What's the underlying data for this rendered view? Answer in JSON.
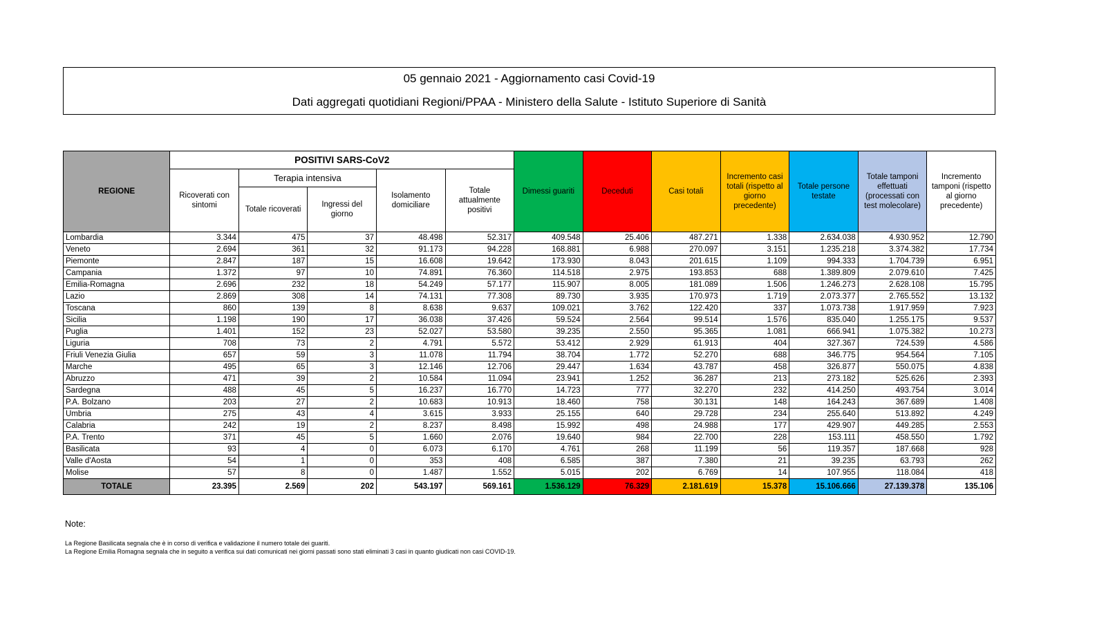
{
  "title": "05 gennaio 2021 - Aggiornamento casi Covid-19",
  "subtitle": "Dati aggregati quotidiani Regioni/PPAA - Ministero della Salute - Istituto Superiore di Sanità",
  "headers": {
    "regione": "REGIONE",
    "positivi": "POSITIVI SARS-CoV2",
    "terapia": "Terapia intensiva",
    "ricoverati": "Ricoverati con sintomi",
    "totale_ricoverati": "Totale ricoverati",
    "ingressi": "Ingressi del giorno",
    "isolamento": "Isolamento domiciliare",
    "totale_positivi": "Totale attualmente positivi",
    "dimessi": "Dimessi guariti",
    "deceduti": "Deceduti",
    "casi_totali": "Casi totali",
    "incremento_casi": "Incremento casi totali (rispetto al giorno precedente)",
    "persone_testate": "Totale persone testate",
    "tamponi": "Totale tamponi effettuati (processati con test molecolare)",
    "incremento_tamponi": "Incremento tamponi (rispetto al giorno precedente)"
  },
  "rows": [
    [
      "Lombardia",
      "3.344",
      "475",
      "37",
      "48.498",
      "52.317",
      "409.548",
      "25.406",
      "487.271",
      "1.338",
      "2.634.038",
      "4.930.952",
      "12.790"
    ],
    [
      "Veneto",
      "2.694",
      "361",
      "32",
      "91.173",
      "94.228",
      "168.881",
      "6.988",
      "270.097",
      "3.151",
      "1.235.218",
      "3.374.382",
      "17.734"
    ],
    [
      "Piemonte",
      "2.847",
      "187",
      "15",
      "16.608",
      "19.642",
      "173.930",
      "8.043",
      "201.615",
      "1.109",
      "994.333",
      "1.704.739",
      "6.951"
    ],
    [
      "Campania",
      "1.372",
      "97",
      "10",
      "74.891",
      "76.360",
      "114.518",
      "2.975",
      "193.853",
      "688",
      "1.389.809",
      "2.079.610",
      "7.425"
    ],
    [
      "Emilia-Romagna",
      "2.696",
      "232",
      "18",
      "54.249",
      "57.177",
      "115.907",
      "8.005",
      "181.089",
      "1.506",
      "1.246.273",
      "2.628.108",
      "15.795"
    ],
    [
      "Lazio",
      "2.869",
      "308",
      "14",
      "74.131",
      "77.308",
      "89.730",
      "3.935",
      "170.973",
      "1.719",
      "2.073.377",
      "2.765.552",
      "13.132"
    ],
    [
      "Toscana",
      "860",
      "139",
      "8",
      "8.638",
      "9.637",
      "109.021",
      "3.762",
      "122.420",
      "337",
      "1.073.738",
      "1.917.959",
      "7.923"
    ],
    [
      "Sicilia",
      "1.198",
      "190",
      "17",
      "36.038",
      "37.426",
      "59.524",
      "2.564",
      "99.514",
      "1.576",
      "835.040",
      "1.255.175",
      "9.537"
    ],
    [
      "Puglia",
      "1.401",
      "152",
      "23",
      "52.027",
      "53.580",
      "39.235",
      "2.550",
      "95.365",
      "1.081",
      "666.941",
      "1.075.382",
      "10.273"
    ],
    [
      "Liguria",
      "708",
      "73",
      "2",
      "4.791",
      "5.572",
      "53.412",
      "2.929",
      "61.913",
      "404",
      "327.367",
      "724.539",
      "4.586"
    ],
    [
      "Friuli Venezia Giulia",
      "657",
      "59",
      "3",
      "11.078",
      "11.794",
      "38.704",
      "1.772",
      "52.270",
      "688",
      "346.775",
      "954.564",
      "7.105"
    ],
    [
      "Marche",
      "495",
      "65",
      "3",
      "12.146",
      "12.706",
      "29.447",
      "1.634",
      "43.787",
      "458",
      "326.877",
      "550.075",
      "4.838"
    ],
    [
      "Abruzzo",
      "471",
      "39",
      "2",
      "10.584",
      "11.094",
      "23.941",
      "1.252",
      "36.287",
      "213",
      "273.182",
      "525.626",
      "2.393"
    ],
    [
      "Sardegna",
      "488",
      "45",
      "5",
      "16.237",
      "16.770",
      "14.723",
      "777",
      "32.270",
      "232",
      "414.250",
      "493.754",
      "3.014"
    ],
    [
      "P.A. Bolzano",
      "203",
      "27",
      "2",
      "10.683",
      "10.913",
      "18.460",
      "758",
      "30.131",
      "148",
      "164.243",
      "367.689",
      "1.408"
    ],
    [
      "Umbria",
      "275",
      "43",
      "4",
      "3.615",
      "3.933",
      "25.155",
      "640",
      "29.728",
      "234",
      "255.640",
      "513.892",
      "4.249"
    ],
    [
      "Calabria",
      "242",
      "19",
      "2",
      "8.237",
      "8.498",
      "15.992",
      "498",
      "24.988",
      "177",
      "429.907",
      "449.285",
      "2.553"
    ],
    [
      "P.A. Trento",
      "371",
      "45",
      "5",
      "1.660",
      "2.076",
      "19.640",
      "984",
      "22.700",
      "228",
      "153.111",
      "458.550",
      "1.792"
    ],
    [
      "Basilicata",
      "93",
      "4",
      "0",
      "6.073",
      "6.170",
      "4.761",
      "268",
      "11.199",
      "56",
      "119.357",
      "187.668",
      "928"
    ],
    [
      "Valle d'Aosta",
      "54",
      "1",
      "0",
      "353",
      "408",
      "6.585",
      "387",
      "7.380",
      "21",
      "39.235",
      "63.793",
      "262"
    ],
    [
      "Molise",
      "57",
      "8",
      "0",
      "1.487",
      "1.552",
      "5.015",
      "202",
      "6.769",
      "14",
      "107.955",
      "118.084",
      "418"
    ]
  ],
  "totals": [
    "TOTALE",
    "23.395",
    "2.569",
    "202",
    "543.197",
    "569.161",
    "1.536.129",
    "76.329",
    "2.181.619",
    "15.378",
    "15.106.666",
    "27.139.378",
    "135.106"
  ],
  "notes": {
    "title": "Note:",
    "lines": [
      "La Regione Basilicata segnala che è in corso di verifica e validazione il numero totale dei guariti.",
      "La Regione Emilia  Romagna segnala che in seguito a verifica sui dati comunicati nei giorni passati sono stati eliminati 3 casi in quanto giudicati non casi COVID-19."
    ]
  },
  "colors": {
    "green": "#00b050",
    "red": "#ff0000",
    "yellow": "#ffc000",
    "blue": "#00b0f0",
    "light_blue": "#b4c6e7",
    "grey": "#a6a6a6"
  }
}
